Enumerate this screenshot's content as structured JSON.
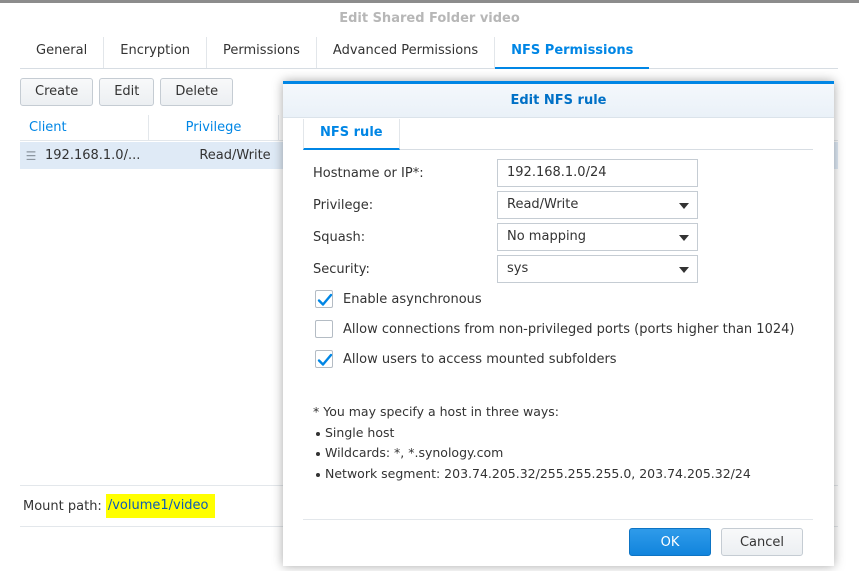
{
  "main_window": {
    "title": "Edit Shared Folder video",
    "tabs": [
      {
        "label": "General"
      },
      {
        "label": "Encryption"
      },
      {
        "label": "Permissions"
      },
      {
        "label": "Advanced Permissions"
      },
      {
        "label": "NFS Permissions",
        "active": true
      }
    ],
    "toolbar": {
      "create_label": "Create",
      "edit_label": "Edit",
      "delete_label": "Delete"
    },
    "grid": {
      "columns": [
        "Client",
        "Privilege"
      ],
      "rows": [
        {
          "client": "192.168.1.0/...",
          "privilege": "Read/Write"
        }
      ]
    },
    "mount": {
      "label": "Mount path:",
      "path": "/volume1/video"
    }
  },
  "dialog": {
    "title": "Edit NFS rule",
    "tab": "NFS rule",
    "fields": {
      "hostname": {
        "label": "Hostname or IP*:",
        "value": "192.168.1.0/24"
      },
      "privilege": {
        "label": "Privilege:",
        "value": "Read/Write"
      },
      "squash": {
        "label": "Squash:",
        "value": "No mapping"
      },
      "security": {
        "label": "Security:",
        "value": "sys"
      }
    },
    "checkboxes": [
      {
        "label": "Enable asynchronous",
        "checked": true
      },
      {
        "label": "Allow connections from non-privileged ports (ports higher than 1024)",
        "checked": false
      },
      {
        "label": "Allow users to access mounted subfolders",
        "checked": true
      }
    ],
    "help": {
      "intro": "* You may specify a host in three ways:",
      "items": [
        "Single host",
        "Wildcards: *, *.synology.com",
        "Network segment: 203.74.205.32/255.255.255.0, 203.74.205.32/24"
      ]
    },
    "buttons": {
      "ok_label": "OK",
      "cancel_label": "Cancel"
    }
  },
  "colors": {
    "accent": "#0086e5",
    "highlight": "#ffff00",
    "selected_row": "#dfeaf6"
  }
}
